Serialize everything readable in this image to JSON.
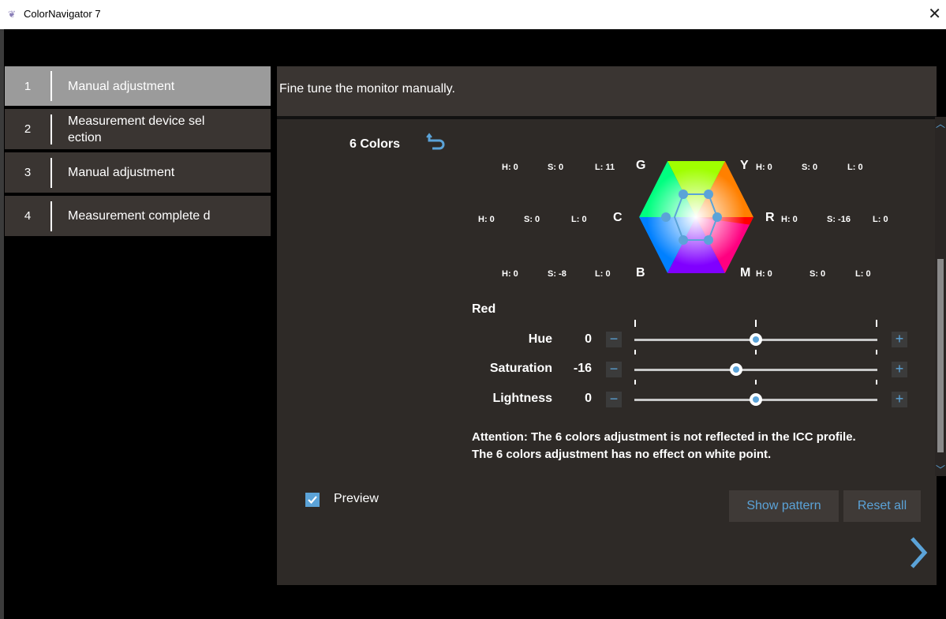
{
  "window": {
    "title": "ColorNavigator 7"
  },
  "steps": [
    {
      "num": "1",
      "label": "Manual adjustment",
      "active": true
    },
    {
      "num": "2",
      "label": "Measurement device sel ection"
    },
    {
      "num": "3",
      "label": "Manual adjustment"
    },
    {
      "num": "4",
      "label": "Measurement complete d"
    }
  ],
  "panel": {
    "description": "Fine tune the monitor manually.",
    "section_title": "6 Colors"
  },
  "colors": {
    "G": {
      "letter": "G",
      "h": "H: 0",
      "s": "S: 0",
      "l": "L: 11"
    },
    "Y": {
      "letter": "Y",
      "h": "H: 0",
      "s": "S: 0",
      "l": "L: 0"
    },
    "C": {
      "letter": "C",
      "h": "H: 0",
      "s": "S: 0",
      "l": "L: 0"
    },
    "R": {
      "letter": "R",
      "h": "H: 0",
      "s": "S: -16",
      "l": "L: 0"
    },
    "B": {
      "letter": "B",
      "h": "H: 0",
      "s": "S: -8",
      "l": "L: 0"
    },
    "M": {
      "letter": "M",
      "h": "H: 0",
      "s": "S: 0",
      "l": "L: 0"
    }
  },
  "selected_color": "Red",
  "sliders": [
    {
      "label": "Hue",
      "value": "0",
      "fraction": 0.5
    },
    {
      "label": "Saturation",
      "value": "-16",
      "fraction": 0.42
    },
    {
      "label": "Lightness",
      "value": "0",
      "fraction": 0.5
    }
  ],
  "attention": {
    "line1": "Attention: The 6 colors adjustment is not reflected in the ICC profile.",
    "line2": "The 6 colors adjustment has no effect on white point."
  },
  "preview": {
    "label": "Preview",
    "checked": true
  },
  "buttons": {
    "show_pattern": "Show pattern",
    "reset_all": "Reset all"
  },
  "icons": {
    "undo": "undo-icon",
    "next": "chevron-right-icon",
    "close": "close-icon"
  },
  "accent_color": "#5ba3d8"
}
